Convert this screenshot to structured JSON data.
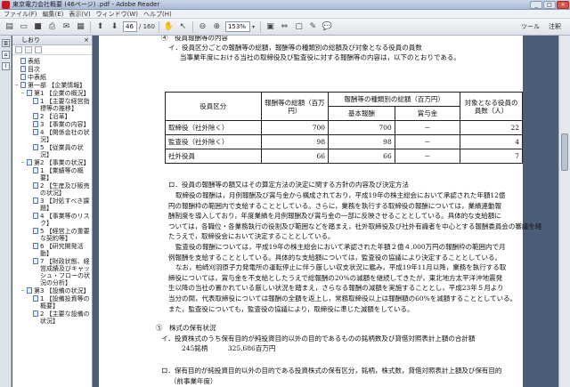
{
  "window": {
    "title": "東京電力会社概要 (46ページ) .pdf - Adobe Reader"
  },
  "menu": [
    "ファイル(F)",
    "編集(E)",
    "表示(V)",
    "ウィンドウ(W)",
    "ヘルプ(H)"
  ],
  "toolbar": {
    "page_current": "46",
    "page_total": "/ 160",
    "zoom": "153%",
    "tools_label": "ツール",
    "comment_label": "注釈"
  },
  "bookmarks": {
    "header": "しおり",
    "items": [
      {
        "label": "表紙",
        "level": 0,
        "exp": ""
      },
      {
        "label": "目次",
        "level": 0,
        "exp": ""
      },
      {
        "label": "中表紙",
        "level": 0,
        "exp": ""
      },
      {
        "label": "第一部 【企業情報】",
        "level": 0,
        "exp": "−"
      },
      {
        "label": "第1 【企業の概況】",
        "level": 1,
        "exp": "−"
      },
      {
        "label": "1 【主要な経営指標等の推移】",
        "level": 2,
        "exp": ""
      },
      {
        "label": "2 【沿革】",
        "level": 2,
        "exp": ""
      },
      {
        "label": "3 【事業の内容】",
        "level": 2,
        "exp": ""
      },
      {
        "label": "4 【関係会社の状況】",
        "level": 2,
        "exp": ""
      },
      {
        "label": "5 【従業員の状況】",
        "level": 2,
        "exp": ""
      },
      {
        "label": "第2 【事業の状況】",
        "level": 1,
        "exp": "−"
      },
      {
        "label": "1 【業績等の概要】",
        "level": 2,
        "exp": ""
      },
      {
        "label": "2 【生産及び販売の状況】",
        "level": 2,
        "exp": ""
      },
      {
        "label": "3 【対処すべき課題】",
        "level": 2,
        "exp": ""
      },
      {
        "label": "4 【事業等のリスク】",
        "level": 2,
        "exp": ""
      },
      {
        "label": "5 【経営上の重要な契約等】",
        "level": 2,
        "exp": ""
      },
      {
        "label": "6 【研究開発活動】",
        "level": 2,
        "exp": ""
      },
      {
        "label": "7 【財政状態、経営成績及びキャッシュ・フローの状況の分析】",
        "level": 2,
        "exp": ""
      },
      {
        "label": "第3 【設備の状況】",
        "level": 1,
        "exp": "−"
      },
      {
        "label": "1 【設備投資等の概要】",
        "level": 2,
        "exp": ""
      },
      {
        "label": "2 【主要な設備の状況】",
        "level": 2,
        "exp": ""
      }
    ]
  },
  "doc": {
    "h4": "④　役員報酬等の内容",
    "i_title": "イ．役員区分ごとの報酬等の総額，報酬等の種類別の総額及び対象となる役員の員数",
    "i_sub": "当事業年度における当社の取締役及び監査役に対する報酬等の内容は，以下のとおりである。",
    "table": {
      "col_kubun": "役員区分",
      "col_total": "報酬等の総額（百万円）",
      "col_kinds": "報酬等の種類別の総額（百万円）",
      "col_kihon": "基本報酬",
      "col_shoyo": "賞与金",
      "col_count": "対象となる役員の員数（人）",
      "rows": [
        {
          "kubun": "取締役（社外除く）",
          "total": "700",
          "kihon": "700",
          "shoyo": "－",
          "count": "22"
        },
        {
          "kubun": "監査役（社外除く）",
          "total": "98",
          "kihon": "98",
          "shoyo": "－",
          "count": "4"
        },
        {
          "kubun": "社外役員",
          "total": "66",
          "kihon": "66",
          "shoyo": "－",
          "count": "7"
        }
      ]
    },
    "ro_title": "ロ．役員の報酬等の額又はその算定方法の決定に関する方針の内容及び決定方法",
    "ro_lines": [
      "取締役の報酬は，月例報酬及び賞与金から構成されており，平成19年の株主総会において承認された年額12億",
      "円の報酬枠の範囲内で支給することとしている。さらに，業務を執行する取締役の報酬については，業績連動報",
      "酬制度を導入しており，年度業績を月例報酬及び賞与金の一部に反映させることとしている。具体的な支給額に",
      "ついては，各職位・各業務執行の役割及び範囲などを踏まえ，社外取締役及び社外有識者を中心とする報酬委員会の審議を経",
      "たうえで，取締役会において決定することとしている。",
      "監査役の報酬については，平成19年の株主総会において承認された年額２億４,000万円の報酬枠の範囲内で月",
      "例報酬を支給することとしている。具体的な支給額については，監査役の協議により決定することとしている。",
      "なお，柏崎刈羽原子力発電所の運転停止に伴う厳しい収支状況に鑑み，平成19年11月以降，業務を執行する取",
      "締役については，賞与金を不支給としたうえで総報酬の20%の減額を継続してきたが，東北地方太平洋沖地震発",
      "生以降の当社の置かれている厳しい状況を踏まえ，さらなる報酬の減額を実施することとし，平成23年５月より",
      "当分の間，代表取締役については報酬の全額を返上し，常務取締役以上は報酬額の60%を減額することとしている。",
      "また，監査役についても，監査役の協議により，取締役に準じた減額をしている。"
    ],
    "h5": "⑤　株式の保有状況",
    "h5_i": "イ．投資株式のうち保有目的が純投資目的以外の目的であるものの銘柄数及び貸借対照表計上額の合計額",
    "h5_i_value": "245銘柄　　　325,686百万円",
    "h5_ro": "ロ．保有目的が純投資目的以外の目的である投資株式の保有区分，銘柄，株式数，貸借対照表計上額及び保有目的",
    "h5_ro_sub": "（前事業年度）"
  }
}
